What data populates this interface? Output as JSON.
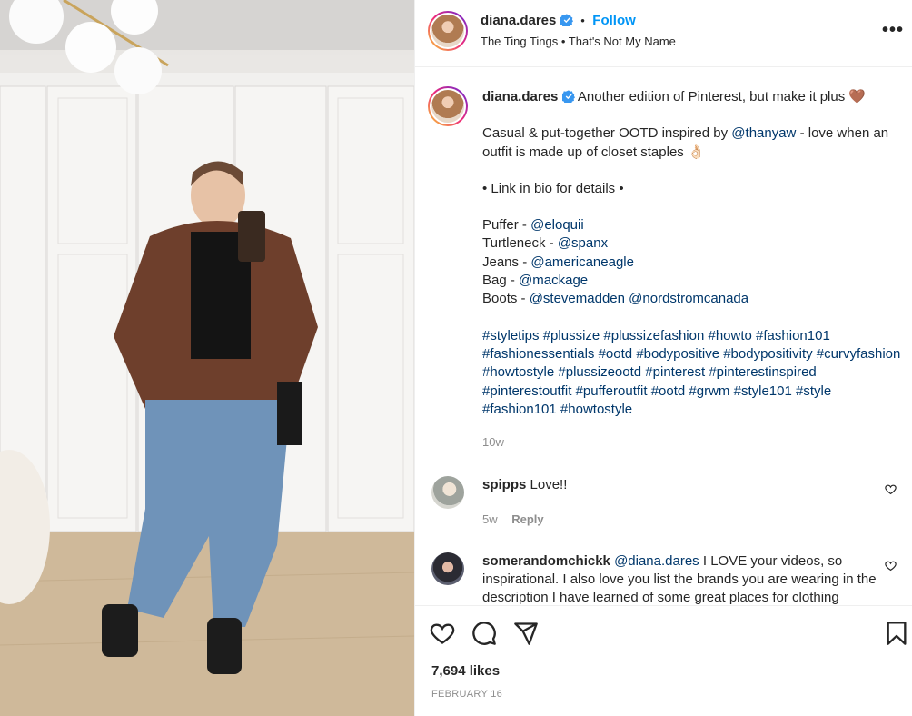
{
  "post": {
    "username": "diana.dares",
    "follow_label": "Follow",
    "separator": "•",
    "audio": "The Ting Tings • That's Not My Name",
    "more_label": "•••"
  },
  "caption": {
    "username": "diana.dares",
    "title": "Another edition of Pinterest, but make it plus 🤎",
    "line1_pre": "Casual & put-together OOTD inspired by ",
    "line1_mention": "@thanyaw",
    "line1_post": " - love when an outfit is made up of closet staples 👌🏻",
    "link_line": "• Link in bio for details •",
    "items": [
      {
        "label": "Puffer - ",
        "mentions": [
          "@eloquii"
        ]
      },
      {
        "label": "Turtleneck - ",
        "mentions": [
          "@spanx"
        ]
      },
      {
        "label": "Jeans - ",
        "mentions": [
          "@americaneagle"
        ]
      },
      {
        "label": "Bag - ",
        "mentions": [
          "@mackage"
        ]
      },
      {
        "label": "Boots - ",
        "mentions": [
          "@stevemadden",
          "@nordstromcanada"
        ]
      }
    ],
    "hashtags": "#styletips #plussize #plussizefashion #howto #fashion101 #fashionessentials #ootd #bodypositive #bodypositivity #curvyfashion #howtostyle #plussizeootd #pinterest #pinterestinspired #pinterestoutfit #pufferoutfit #ootd #grwm #style101 #style #fashion101 #howtostyle",
    "time": "10w"
  },
  "comments": [
    {
      "username": "spipps",
      "text": "Love!!",
      "time": "5w",
      "reply": "Reply"
    },
    {
      "username": "somerandomchickk",
      "mention": "@diana.dares",
      "text": " I LOVE your videos, so inspirational. I also love you list the brands you are wearing in the description I have learned of some great places for clothing"
    }
  ],
  "footer": {
    "likes": "7,694 likes",
    "date": "FEBRUARY 16"
  },
  "colors": {
    "link": "#00376b",
    "follow": "#0095f6",
    "verified": "#3897f0",
    "muted": "#8e8e8e"
  },
  "icons": [
    "verified-icon",
    "heart-icon",
    "comment-icon",
    "share-icon",
    "bookmark-icon",
    "more-icon"
  ]
}
